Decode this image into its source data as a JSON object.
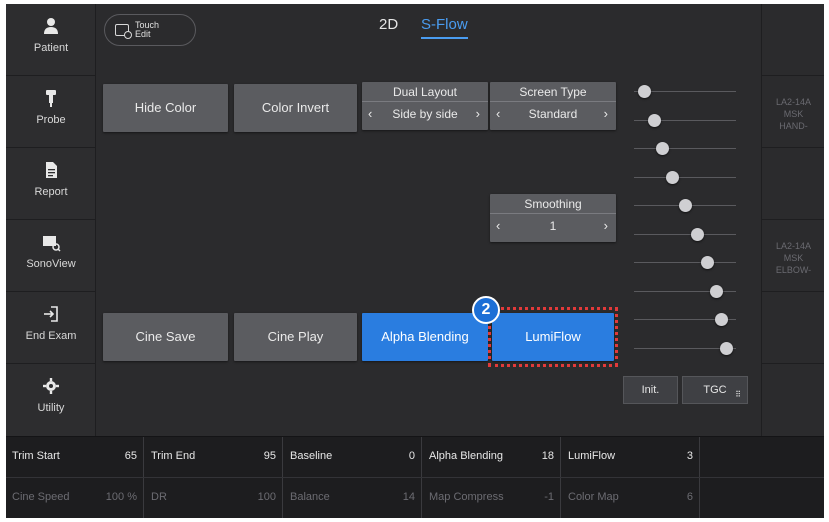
{
  "sidebar": {
    "items": [
      {
        "label": "Patient",
        "icon": "person-icon"
      },
      {
        "label": "Probe",
        "icon": "probe-icon"
      },
      {
        "label": "Report",
        "icon": "document-icon"
      },
      {
        "label": "SonoView",
        "icon": "sonoview-icon"
      },
      {
        "label": "End Exam",
        "icon": "exit-icon"
      },
      {
        "label": "Utility",
        "icon": "gear-icon"
      }
    ]
  },
  "header": {
    "touch_edit_line1": "Touch",
    "touch_edit_line2": "Edit",
    "tab_2d": "2D",
    "tab_sflow": "S-Flow"
  },
  "controls": {
    "hide_color": "Hide Color",
    "color_invert": "Color Invert",
    "dual_layout": {
      "title": "Dual Layout",
      "value": "Side by side"
    },
    "screen_type": {
      "title": "Screen Type",
      "value": "Standard"
    },
    "smoothing": {
      "title": "Smoothing",
      "value": "1"
    },
    "cine_save": "Cine Save",
    "cine_play": "Cine Play",
    "alpha_blending": "Alpha Blending",
    "lumiflow": "LumiFlow",
    "step_number": "2",
    "chevron_left": "‹",
    "chevron_right": "›"
  },
  "tgc": {
    "levels": [
      0.1,
      0.2,
      0.27,
      0.37,
      0.5,
      0.62,
      0.72,
      0.8,
      0.85,
      0.9
    ],
    "init_label": "Init.",
    "tgc_label": "TGC"
  },
  "probes": [
    {
      "line1": "LA2-14A",
      "line2": "MSK",
      "line3": "HAND-"
    },
    {
      "line1": "LA2-14A",
      "line2": "MSK",
      "line3": "ELBOW-"
    }
  ],
  "params": {
    "row1": [
      {
        "name": "Trim Start",
        "value": "65"
      },
      {
        "name": "Trim End",
        "value": "95"
      },
      {
        "name": "Baseline",
        "value": "0"
      },
      {
        "name": "Alpha Blending",
        "value": "18"
      },
      {
        "name": "LumiFlow",
        "value": "3"
      }
    ],
    "row2": [
      {
        "name": "Cine Speed",
        "value": "100 %"
      },
      {
        "name": "DR",
        "value": "100"
      },
      {
        "name": "Balance",
        "value": "14"
      },
      {
        "name": "Map Compress",
        "value": "-1"
      },
      {
        "name": "Color Map",
        "value": "6"
      }
    ]
  },
  "colors": {
    "accent_blue": "#2a7de0",
    "highlight_red": "#e23a3a",
    "panel": "#2b2b2d",
    "button": "#5b5c60"
  }
}
